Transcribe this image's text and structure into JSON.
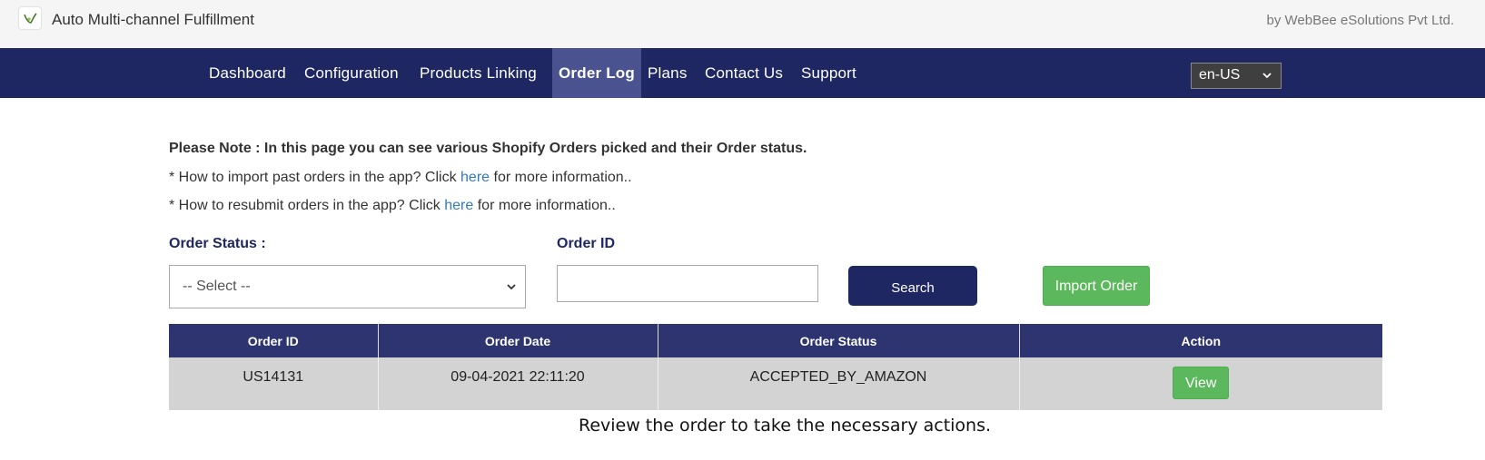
{
  "header": {
    "app_title": "Auto Multi-channel Fulfillment",
    "vendor": "by WebBee eSolutions Pvt Ltd.",
    "logo_icon": "leaf-logo-icon"
  },
  "nav": {
    "items": [
      {
        "label": "Dashboard"
      },
      {
        "label": "Configuration"
      },
      {
        "label": "Products Linking"
      },
      {
        "label": "Order Log",
        "active": true
      },
      {
        "label": "Plans"
      },
      {
        "label": "Contact Us"
      },
      {
        "label": "Support"
      }
    ],
    "language": "en-US"
  },
  "notes": {
    "bold_note": "Please Note : In this page you can see various Shopify Orders picked and their Order status.",
    "import_prefix": "* How to import past orders in the app? Click ",
    "import_link": "here",
    "import_suffix": " for more information..",
    "resubmit_prefix": "* How to resubmit orders in the app? Click ",
    "resubmit_link": "here",
    "resubmit_suffix": " for more information.."
  },
  "filters": {
    "status_label": "Order Status :",
    "status_value": "-- Select --",
    "order_id_label": "Order ID",
    "order_id_value": "",
    "search_label": "Search",
    "import_label": "Import Order"
  },
  "table": {
    "headers": [
      "Order ID",
      "Order Date",
      "Order Status",
      "Action"
    ],
    "rows": [
      {
        "order_id": "US14131",
        "order_date": "09-04-2021 22:11:20",
        "order_status": "ACCEPTED_BY_AMAZON",
        "action": "View"
      }
    ]
  },
  "hint": "Review the order to take the necessary actions.",
  "colors": {
    "nav_bg": "#1e2761",
    "nav_active": "#4a5290",
    "table_header": "#2d3470",
    "success": "#5cb85c",
    "link": "#337ab7"
  }
}
